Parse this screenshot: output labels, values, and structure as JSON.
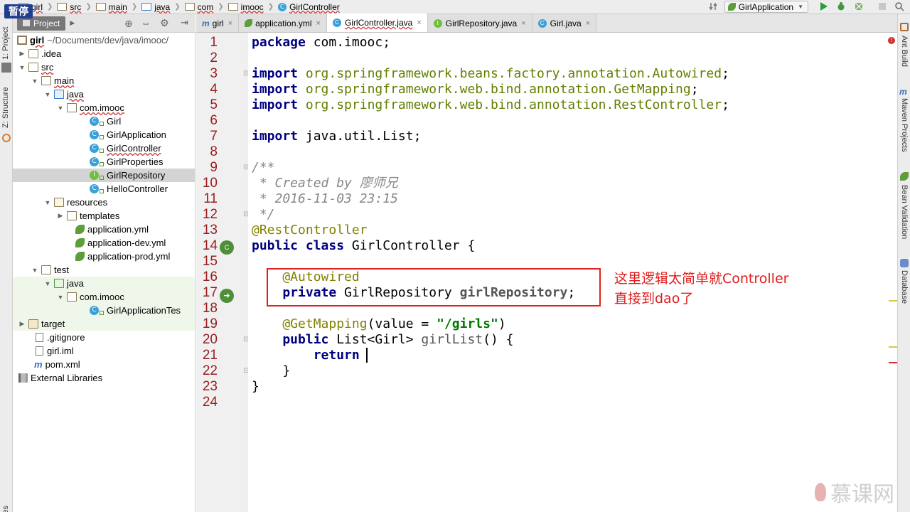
{
  "pause_badge": "暂停",
  "breadcrumbs": [
    "girl",
    "src",
    "main",
    "java",
    "com",
    "imooc",
    "GirlController"
  ],
  "run_config": "GirlApplication",
  "left_tools": {
    "project": "1: Project",
    "structure": "Z: Structure",
    "favorites": "orites"
  },
  "right_tools": {
    "ant": "Ant Build",
    "maven": "Maven Projects",
    "bean": "Bean Validation",
    "database": "Database"
  },
  "project_panel": {
    "tab": "Project"
  },
  "tree": [
    {
      "label": "girl",
      "extra": "~/Documents/dev/java/imooc/",
      "icon": "module-folder-icon"
    },
    {
      "label": ".idea",
      "icon": "folder-icon"
    },
    {
      "label": "src",
      "icon": "folder-icon"
    },
    {
      "label": "main",
      "icon": "folder-icon"
    },
    {
      "label": "java",
      "icon": "source-folder-icon"
    },
    {
      "label": "com.imooc",
      "icon": "package-icon"
    },
    {
      "label": "Girl",
      "icon": "class-icon"
    },
    {
      "label": "GirlApplication",
      "icon": "spring-class-icon"
    },
    {
      "label": "GirlController",
      "icon": "class-icon"
    },
    {
      "label": "GirlProperties",
      "icon": "class-icon"
    },
    {
      "label": "GirlRepository",
      "icon": "interface-icon"
    },
    {
      "label": "HelloController",
      "icon": "class-icon"
    },
    {
      "label": "resources",
      "icon": "resources-folder-icon"
    },
    {
      "label": "templates",
      "icon": "folder-icon"
    },
    {
      "label": "application.yml",
      "icon": "yml-icon"
    },
    {
      "label": "application-dev.yml",
      "icon": "yml-icon"
    },
    {
      "label": "application-prod.yml",
      "icon": "yml-icon"
    },
    {
      "label": "test",
      "icon": "folder-icon"
    },
    {
      "label": "java",
      "icon": "test-folder-icon"
    },
    {
      "label": "com.imooc",
      "icon": "package-icon"
    },
    {
      "label": "GirlApplicationTes",
      "icon": "spring-class-icon"
    },
    {
      "label": "target",
      "icon": "folder-icon"
    },
    {
      "label": ".gitignore",
      "icon": "file-icon"
    },
    {
      "label": "girl.iml",
      "icon": "file-icon"
    },
    {
      "label": "pom.xml",
      "icon": "maven-icon"
    },
    {
      "label": "External Libraries",
      "icon": "libraries-icon"
    }
  ],
  "editor_tabs": [
    {
      "label": "girl",
      "icon": "maven-icon"
    },
    {
      "label": "application.yml",
      "icon": "yml-icon"
    },
    {
      "label": "GirlController.java",
      "icon": "class-icon",
      "active": true
    },
    {
      "label": "GirlRepository.java",
      "icon": "interface-icon"
    },
    {
      "label": "Girl.java",
      "icon": "class-icon"
    }
  ],
  "line_numbers": [
    "1",
    "2",
    "3",
    "4",
    "5",
    "6",
    "7",
    "8",
    "9",
    "10",
    "11",
    "12",
    "13",
    "14",
    "15",
    "16",
    "17",
    "18",
    "19",
    "20",
    "21",
    "22",
    "23",
    "24"
  ],
  "code": {
    "l1_kw": "package",
    "l1_rest": " com.imooc;",
    "l3_kw": "import",
    "l3_pkg": " org.springframework.beans.factory.annotation.Autowired",
    "l3_end": ";",
    "l4_kw": "import",
    "l4_pkg": " org.springframework.web.bind.annotation.GetMapping",
    "l4_end": ";",
    "l5_kw": "import",
    "l5_pkg": " org.springframework.web.bind.annotation.RestController",
    "l5_end": ";",
    "l7_kw": "import",
    "l7_rest": " java.util.List;",
    "l9": "/**",
    "l10": " * Created by 廖师兄",
    "l11": " * 2016-11-03 23:15",
    "l12": " */",
    "l13": "@RestController",
    "l14_kw": "public class",
    "l14_rest": " GirlController {",
    "l16": "    @Autowired",
    "l17_kw": "    private",
    "l17_type": " GirlRepository ",
    "l17_field": "girlRepository",
    "l17_end": ";",
    "l19_an": "    @GetMapping",
    "l19_a": "(value = ",
    "l19_str": "\"/girls\"",
    "l19_b": ")",
    "l20_kw": "    public",
    "l20_type": " List<Girl> ",
    "l20_m": "girlList",
    "l20_rest": "() {",
    "l21_kw": "        return",
    "l22": "    }",
    "l23": "}"
  },
  "annotation_note": [
    "这里逻辑太简单就Controller",
    "直接到dao了"
  ],
  "watermark": "慕课网",
  "colors": {
    "highlight_box": "#e02020",
    "note_text": "#e01b1b",
    "line_numbers": "#9a1d1d"
  }
}
